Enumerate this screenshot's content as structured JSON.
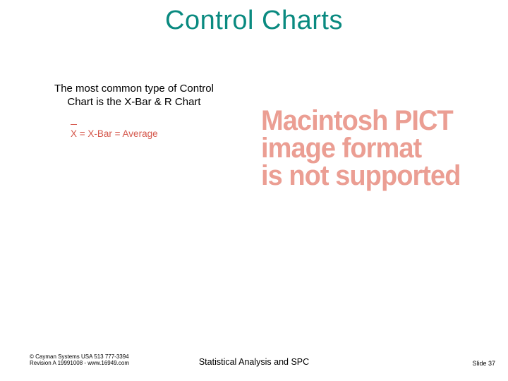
{
  "title": "Control Charts",
  "subtitle_line1": "The most common type of Control",
  "subtitle_line2": "Chart is the X-Bar & R Chart",
  "formula": {
    "x": "X",
    "rest": " = X-Bar = Average"
  },
  "pict": {
    "l1": "Macintosh PICT",
    "l2": "image format",
    "l3": "is not supported"
  },
  "footer": {
    "copyright": "© Cayman Systems USA 513 777-3394",
    "revision": "Revision A 19991008 - www.16949.com",
    "center": "Statistical Analysis and SPC",
    "slide": "Slide 37"
  }
}
